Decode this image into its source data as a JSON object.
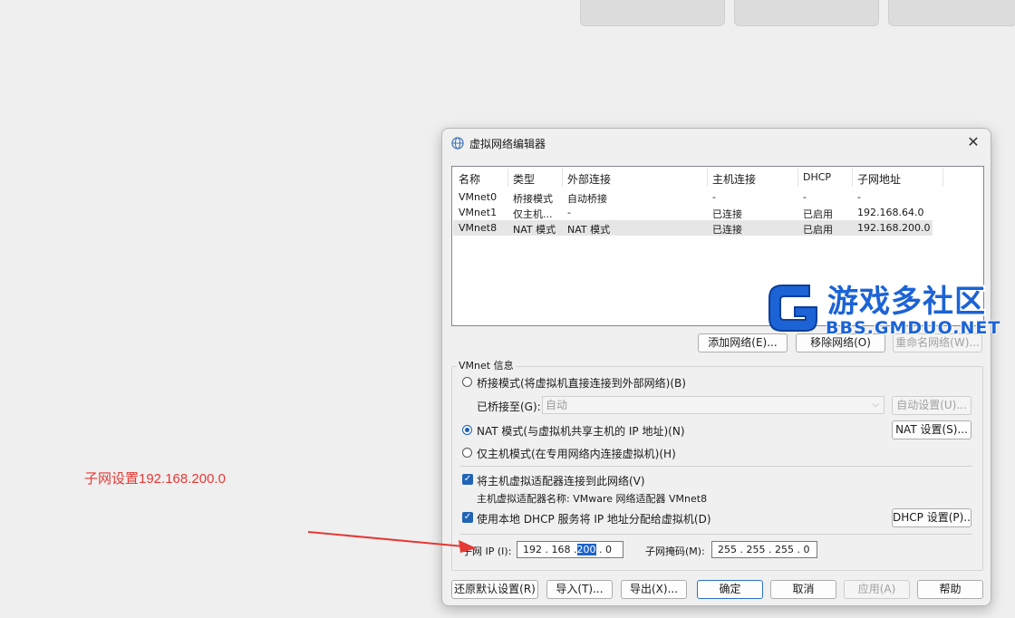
{
  "annotation": {
    "text": "子网设置192.168.200.0",
    "color": "#e53935"
  },
  "dialog": {
    "title": "虚拟网络编辑器",
    "close_glyph": "✕",
    "table": {
      "headers": [
        "名称",
        "类型",
        "外部连接",
        "主机连接",
        "DHCP",
        "子网地址"
      ],
      "rows": [
        [
          "VMnet0",
          "桥接模式",
          "自动桥接",
          "-",
          "-",
          "-"
        ],
        [
          "VMnet1",
          "仅主机...",
          "-",
          "已连接",
          "已启用",
          "192.168.64.0"
        ],
        [
          "VMnet8",
          "NAT 模式",
          "NAT 模式",
          "已连接",
          "已启用",
          "192.168.200.0"
        ]
      ],
      "selected_row": 2
    },
    "list_buttons": {
      "add": "添加网络(E)...",
      "remove": "移除网络(O)",
      "rename": "重命名网络(W)..."
    },
    "vmnet_info": {
      "group_label": "VMnet 信息",
      "bridged_label": "桥接模式(将虚拟机直接连接到外部网络)(B)",
      "bridged_to_label": "已桥接至(G):",
      "bridged_to_value": "自动",
      "auto_settings": "自动设置(U)...",
      "nat_label": "NAT 模式(与虚拟机共享主机的 IP 地址)(N)",
      "nat_settings": "NAT 设置(S)...",
      "hostonly_label": "仅主机模式(在专用网络内连接虚拟机)(H)",
      "connect_adapter_label": "将主机虚拟适配器连接到此网络(V)",
      "adapter_name_label": "主机虚拟适配器名称: VMware 网络适配器 VMnet8",
      "dhcp_label": "使用本地 DHCP 服务将 IP 地址分配给虚拟机(D)",
      "dhcp_settings": "DHCP 设置(P)...",
      "subnet_ip_label": "子网 IP (I):",
      "subnet_ip_parts": [
        "192",
        "168",
        "200",
        "0"
      ],
      "subnet_mask_label": "子网掩码(M):",
      "subnet_mask_value": "255 . 255 . 255 .  0"
    },
    "bottom_buttons": {
      "restore": "还原默认设置(R)",
      "import": "导入(T)...",
      "export": "导出(X)...",
      "ok": "确定",
      "cancel": "取消",
      "apply": "应用(A)",
      "help": "帮助"
    }
  },
  "watermark": {
    "title": "游戏多社区",
    "subtitle": "BBS.GMDUO.NET",
    "color": "#1c63d6"
  }
}
